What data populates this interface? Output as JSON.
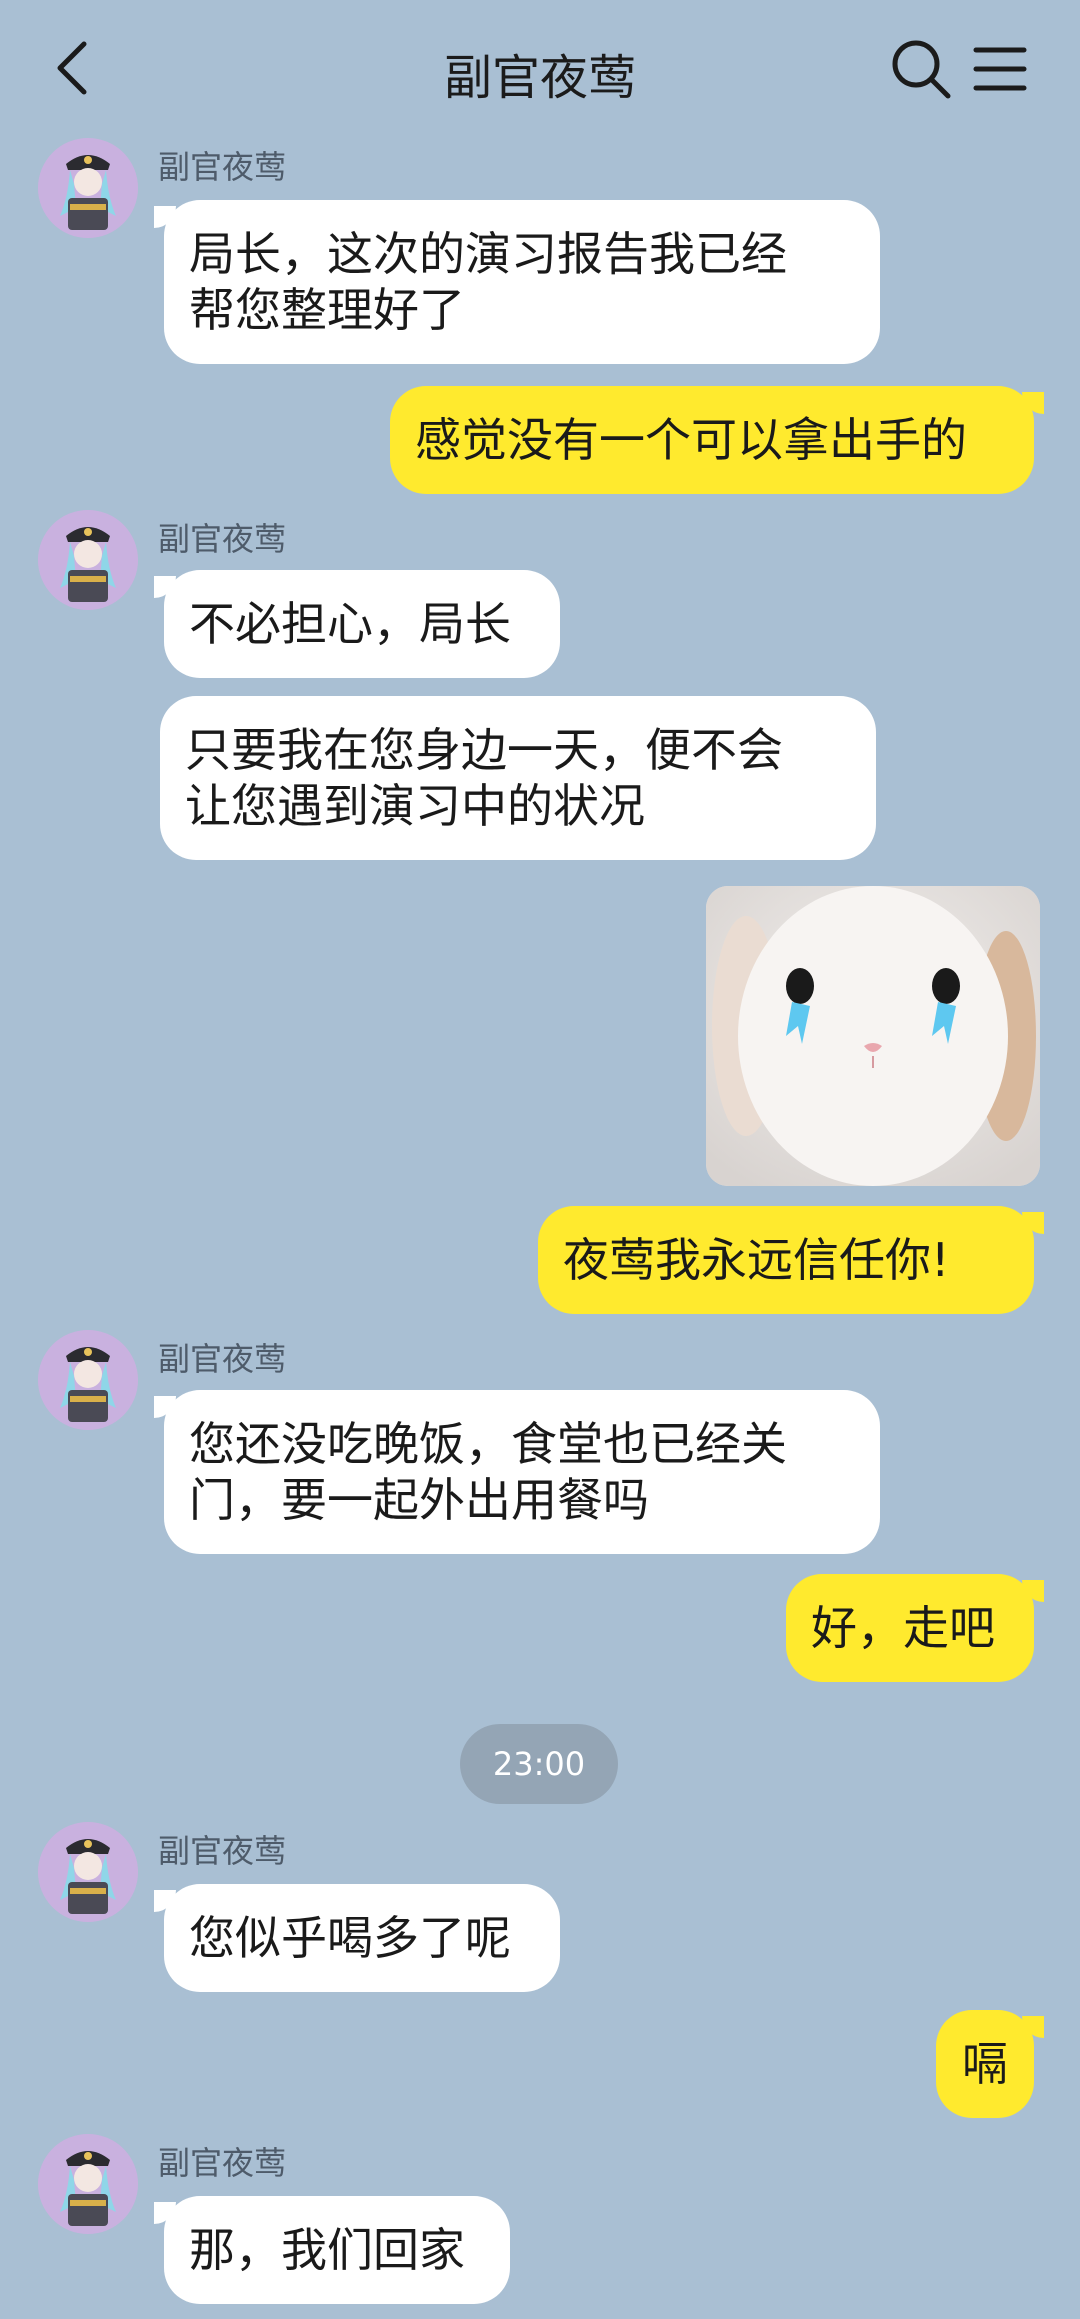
{
  "header": {
    "title": "副官夜莺",
    "icons": [
      "back-arrow-icon",
      "search-icon",
      "menu-icon"
    ]
  },
  "messages": [
    {
      "side": "left",
      "sender": "副官夜莺",
      "lines": [
        "局长，这次的演习报告我已经",
        "帮您整理好了"
      ]
    },
    {
      "side": "right",
      "lines": [
        "感觉没有一个可以拿出手的"
      ]
    },
    {
      "side": "left",
      "sender": "副官夜莺",
      "lines": [
        "不必担心，局长"
      ]
    },
    {
      "side": "left",
      "lines": [
        "只要我在您身边一天，便不会",
        "让您遇到演习中的状况"
      ]
    },
    {
      "side": "right",
      "type": "image",
      "image": "crying-white-bunny-sticker"
    },
    {
      "side": "right",
      "lines": [
        "夜莺我永远信任你!"
      ]
    },
    {
      "side": "left",
      "sender": "副官夜莺",
      "lines": [
        "您还没吃晚饭，食堂也已经关",
        "门，要一起外出用餐吗"
      ]
    },
    {
      "side": "right",
      "lines": [
        "好，走吧"
      ]
    },
    {
      "side": "left",
      "sender": "副官夜莺",
      "lines": [
        "您似乎喝多了呢"
      ]
    },
    {
      "side": "right",
      "lines": [
        "嗝"
      ]
    },
    {
      "side": "left",
      "sender": "副官夜莺",
      "lines": [
        "那，我们回家"
      ]
    }
  ],
  "timestamp": "23:00",
  "colors": {
    "background": "#a9bfd3",
    "incoming_bubble": "#ffffff",
    "outgoing_bubble": "#ffea2e",
    "timestamp_pill": "#94a5b5"
  }
}
